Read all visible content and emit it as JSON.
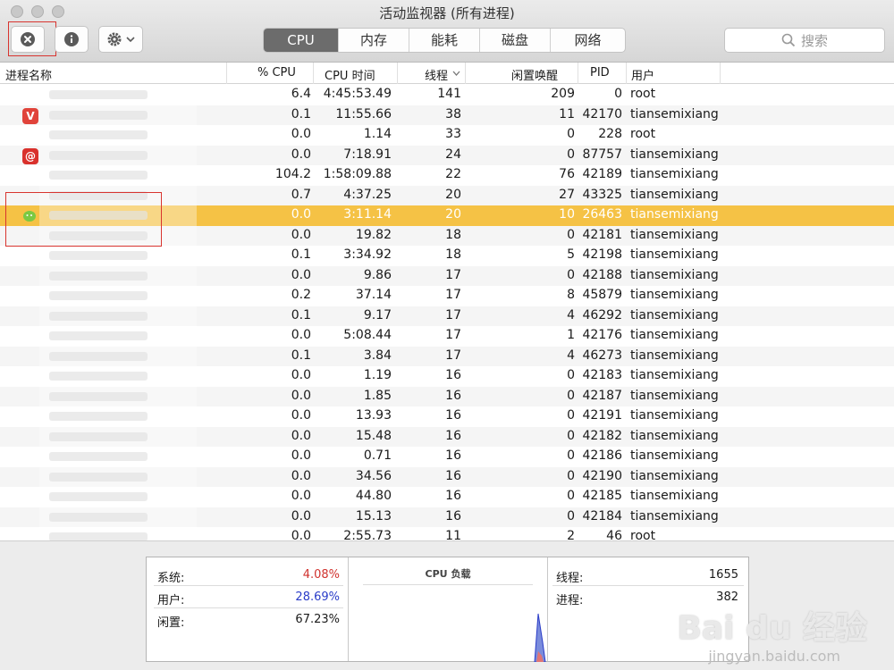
{
  "window": {
    "title": "活动监视器 (所有进程)"
  },
  "toolbar": {
    "tabs": [
      {
        "label": "CPU",
        "active": true
      },
      {
        "label": "内存",
        "active": false
      },
      {
        "label": "能耗",
        "active": false
      },
      {
        "label": "磁盘",
        "active": false
      },
      {
        "label": "网络",
        "active": false
      }
    ],
    "search_placeholder": "搜索",
    "icons": [
      "quit-process-icon",
      "info-icon",
      "gear-icon",
      "chevron-down-icon",
      "search-icon"
    ]
  },
  "columns": {
    "name": "进程名称",
    "cpu_percent": "% CPU",
    "cpu_time": "CPU 时间",
    "threads": "线程",
    "idle_wakeups": "闲置唤醒",
    "pid": "PID",
    "user": "用户"
  },
  "rows": [
    {
      "cpu": "6.4",
      "time": "4:45:53.49",
      "threads": "141",
      "wakeups": "209",
      "pid": "0",
      "user": "root"
    },
    {
      "cpu": "0.1",
      "time": "11:55.66",
      "threads": "38",
      "wakeups": "11",
      "pid": "42170",
      "user": "tiansemixiang",
      "icon": "vivaldi-icon"
    },
    {
      "cpu": "0.0",
      "time": "1.14",
      "threads": "33",
      "wakeups": "0",
      "pid": "228",
      "user": "root"
    },
    {
      "cpu": "0.0",
      "time": "7:18.91",
      "threads": "24",
      "wakeups": "0",
      "pid": "87757",
      "user": "tiansemixiang",
      "icon": "netease-music-icon"
    },
    {
      "cpu": "104.2",
      "time": "1:58:09.88",
      "threads": "22",
      "wakeups": "76",
      "pid": "42189",
      "user": "tiansemixiang"
    },
    {
      "cpu": "0.7",
      "time": "4:37.25",
      "threads": "20",
      "wakeups": "27",
      "pid": "43325",
      "user": "tiansemixiang"
    },
    {
      "cpu": "0.0",
      "time": "3:11.14",
      "threads": "20",
      "wakeups": "10",
      "pid": "26463",
      "user": "tiansemixiang",
      "selected": true,
      "icon": "wechat-icon"
    },
    {
      "cpu": "0.0",
      "time": "19.82",
      "threads": "18",
      "wakeups": "0",
      "pid": "42181",
      "user": "tiansemixiang"
    },
    {
      "cpu": "0.1",
      "time": "3:34.92",
      "threads": "18",
      "wakeups": "5",
      "pid": "42198",
      "user": "tiansemixiang"
    },
    {
      "cpu": "0.0",
      "time": "9.86",
      "threads": "17",
      "wakeups": "0",
      "pid": "42188",
      "user": "tiansemixiang"
    },
    {
      "cpu": "0.2",
      "time": "37.14",
      "threads": "17",
      "wakeups": "8",
      "pid": "45879",
      "user": "tiansemixiang"
    },
    {
      "cpu": "0.1",
      "time": "9.17",
      "threads": "17",
      "wakeups": "4",
      "pid": "46292",
      "user": "tiansemixiang"
    },
    {
      "cpu": "0.0",
      "time": "5:08.44",
      "threads": "17",
      "wakeups": "1",
      "pid": "42176",
      "user": "tiansemixiang"
    },
    {
      "cpu": "0.1",
      "time": "3.84",
      "threads": "17",
      "wakeups": "4",
      "pid": "46273",
      "user": "tiansemixiang"
    },
    {
      "cpu": "0.0",
      "time": "1.19",
      "threads": "16",
      "wakeups": "0",
      "pid": "42183",
      "user": "tiansemixiang"
    },
    {
      "cpu": "0.0",
      "time": "1.85",
      "threads": "16",
      "wakeups": "0",
      "pid": "42187",
      "user": "tiansemixiang"
    },
    {
      "cpu": "0.0",
      "time": "13.93",
      "threads": "16",
      "wakeups": "0",
      "pid": "42191",
      "user": "tiansemixiang"
    },
    {
      "cpu": "0.0",
      "time": "15.48",
      "threads": "16",
      "wakeups": "0",
      "pid": "42182",
      "user": "tiansemixiang"
    },
    {
      "cpu": "0.0",
      "time": "0.71",
      "threads": "16",
      "wakeups": "0",
      "pid": "42186",
      "user": "tiansemixiang"
    },
    {
      "cpu": "0.0",
      "time": "34.56",
      "threads": "16",
      "wakeups": "0",
      "pid": "42190",
      "user": "tiansemixiang"
    },
    {
      "cpu": "0.0",
      "time": "44.80",
      "threads": "16",
      "wakeups": "0",
      "pid": "42185",
      "user": "tiansemixiang"
    },
    {
      "cpu": "0.0",
      "time": "15.13",
      "threads": "16",
      "wakeups": "0",
      "pid": "42184",
      "user": "tiansemixiang"
    },
    {
      "cpu": "0.0",
      "time": "2:55.73",
      "threads": "11",
      "wakeups": "2",
      "pid": "46",
      "user": "root"
    }
  ],
  "summary": {
    "system_label": "系统:",
    "system_value": "4.08%",
    "system_color": "#d0332f",
    "user_label": "用户:",
    "user_value": "28.69%",
    "user_color": "#2a3cc8",
    "idle_label": "闲置:",
    "idle_value": "67.23%",
    "cpu_load_title": "CPU 负载",
    "threads_label": "线程:",
    "threads_value": "1655",
    "processes_label": "进程:",
    "processes_value": "382"
  },
  "watermark": {
    "text": "Bai du 经验",
    "sub": "jingyan.baidu.com"
  }
}
